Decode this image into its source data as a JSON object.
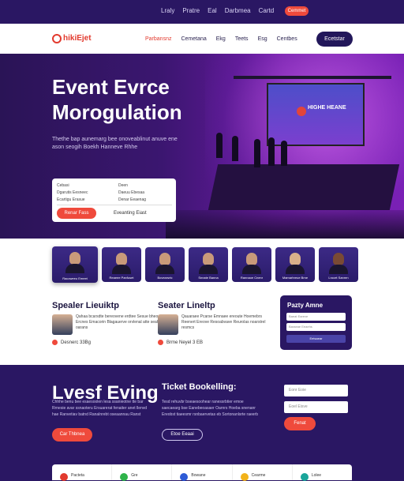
{
  "topbar": {
    "links": [
      "Lraly",
      "Pratre",
      "Eal",
      "Darbmea",
      "Cartd"
    ],
    "button": "Cemmet"
  },
  "nav": {
    "logo": "hikiEjet",
    "menu": [
      "Parbansnz",
      "Cemetana",
      "Ekg",
      "Teets",
      "Esg",
      "Centbes"
    ],
    "button": "Ecetstar"
  },
  "hero": {
    "title": "Event Evrce Morogulation",
    "description": "Thethe bap aunemarg bee onoveablinut anuve ene ason seogih Boekh Hanneve Rhhe",
    "screen_text": "HIGHE HEANE",
    "booking": {
      "fields": [
        "Cebasi",
        "Deen",
        "Dgarutis Eesneec",
        "Daeuu Ebesaa",
        "Ecartigu Erasue",
        "Denar Eeaenag"
      ],
      "button": "Renar Fass",
      "link": "Eveanting Eiast"
    }
  },
  "speakers": {
    "cards": [
      "Racoweeu Emeet",
      "Reaeee Panfuset",
      "Bovearsrtc",
      "Snnate Banna",
      "Rannaoe Cnenr",
      "Mamarhreue Brne",
      "Lrocet Sanren"
    ]
  },
  "lineup": [
    {
      "title": "Spealer Lieuiktp",
      "text": "Qahaa bcarsdte bereovene erdtee Sesue bheorean Ercnes Emacorin Blagauerve orvlenal atte seahe oarans",
      "meta": "Desnerc 33Bg"
    },
    {
      "title": "Seater Lineltp",
      "text": "Qauaraee Pcarse Emnaee ereoute Hoemebrs Reenert Ereove Resoabvave Reurolas noarstrel resmcs",
      "meta": "Brme Neyel 3 EB"
    }
  ],
  "form": {
    "title": "Pazty Amne",
    "fields": [
      "Baeat Eareve",
      "Baraeae Eeaehs"
    ],
    "button": "Eetsaear"
  },
  "dark": {
    "left_title": "Lvesf Eving",
    "left_text": "Chhhe benu bee esaesoolen lesa ssanieotne tte bar Rrnesie avar ssnaoteru Ersuarerat fenaiter anet llenvd hae Ranvetiav batnd Ranalnrebt oseaannau Ranst",
    "left_button": "Car Thbnea",
    "right_title": "Ticket Bookelling:",
    "right_text": "Tesd rehuvbr bseaesoohear ranessrbtier emoe saecaearg bse Eanebeoasaer Oarnrs Hoeba snenanr Ereobst tiaeesmr rsnbaervetas eb Sortonanlsrte raeerb",
    "right_button": "Etoe Eeaai",
    "inputs": [
      "Eonr Eoie",
      "Eoel Eisve"
    ],
    "input_button": "Fenat"
  },
  "partners": [
    {
      "name": "Pacteta",
      "color": "#e23a2e"
    },
    {
      "name": "Gre",
      "color": "#2fb34a"
    },
    {
      "name": "Bowane",
      "color": "#2e5bd6"
    },
    {
      "name": "Cearme",
      "color": "#f2b21a"
    },
    {
      "name": "Lolee",
      "color": "#1aa59a"
    }
  ]
}
